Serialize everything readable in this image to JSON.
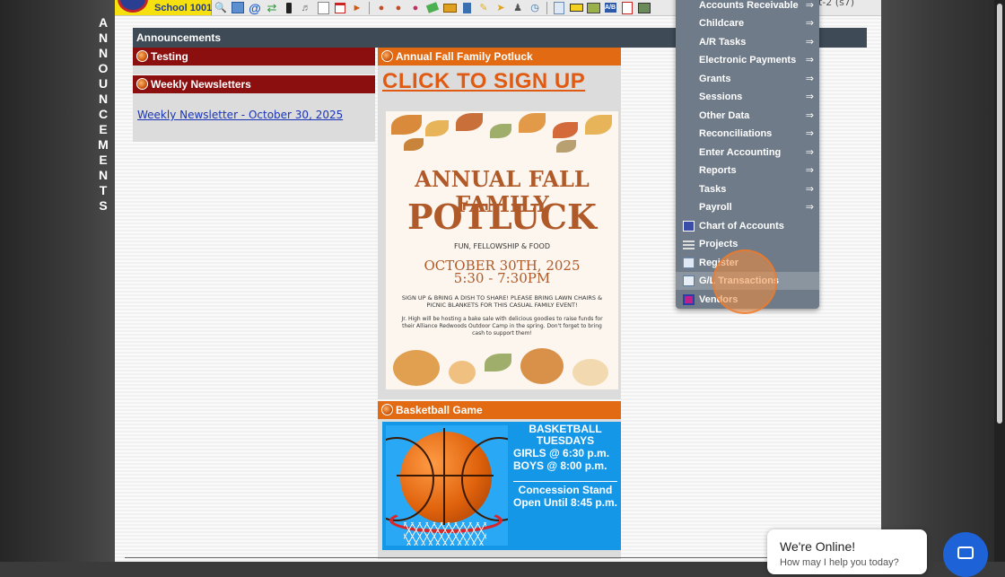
{
  "school": {
    "name": "School 1001"
  },
  "vertical_title": [
    "A",
    "N",
    "N",
    "O",
    "U",
    "N",
    "C",
    "E",
    "M",
    "E",
    "N",
    "T",
    "S"
  ],
  "toolbar": {
    "icons": [
      "magnifier-icon",
      "spreadsheet-icon",
      "at-sign-icon",
      "exchange-icon",
      "phone-icon",
      "speaker-icon",
      "notepad-icon",
      "calendar-icon",
      "megaphone-icon",
      "person-icon",
      "person-icon",
      "people-icon",
      "wallet-icon",
      "ticket-icon",
      "ledger-icon",
      "note-icon",
      "arrow-icon",
      "users-icon",
      "clock-icon",
      "document-icon",
      "card-icon",
      "printer-icon",
      "ab-icon",
      "pdf-icon",
      "money-icon"
    ],
    "topright_fragment": "t-2 (s7)"
  },
  "announcements": {
    "header": "Announcements",
    "testing_title": "Testing",
    "newsletters_title": "Weekly Newsletters",
    "newsletter_link": "Weekly Newsletter - October 30, 2025",
    "potluck_title": "Annual Fall Family Potluck",
    "signup_link": "CLICK TO SIGN UP",
    "flyer": {
      "line1": "ANNUAL FALL FAMILY",
      "line2": "POTLUCK",
      "line3": "FUN, FELLOWSHIP & FOOD",
      "date": "OCTOBER 30TH, 2025",
      "time": "5:30 - 7:30PM",
      "instructions": "SIGN UP & BRING A DISH TO SHARE! PLEASE BRING LAWN CHAIRS & PICNIC BLANKETS FOR THIS CASUAL FAMILY EVENT!",
      "note": "Jr. High will be hosting a bake sale with delicious goodies to raise funds for their Alliance Redwoods Outdoor Camp in the spring. Don't forget to bring cash to support them!"
    },
    "basketball_title": "Basketball Game",
    "basketball": {
      "line1": "BASKETBALL",
      "line2": "TUESDAYS",
      "line3": "GIRLS @ 6:30 p.m.",
      "line4": "BOYS  @ 8:00 p.m.",
      "line5": "Concession Stand",
      "line6": "Open Until 8:45 p.m."
    }
  },
  "menu": {
    "arrow": "⇒",
    "items": [
      {
        "label": "Accounts Receivable",
        "submenu": true
      },
      {
        "label": "Childcare",
        "submenu": true
      },
      {
        "label": "A/R Tasks",
        "submenu": true
      },
      {
        "label": "Electronic Payments",
        "submenu": true
      },
      {
        "label": "Grants",
        "submenu": true
      },
      {
        "label": "Sessions",
        "submenu": true
      },
      {
        "label": "Other Data",
        "submenu": true
      },
      {
        "label": "Reconciliations",
        "submenu": true
      },
      {
        "label": "Enter Accounting",
        "submenu": true
      },
      {
        "label": "Reports",
        "submenu": true
      },
      {
        "label": "Tasks",
        "submenu": true
      },
      {
        "label": "Payroll",
        "submenu": true
      },
      {
        "label": "Chart of Accounts",
        "icon": "chart-of-accounts-icon"
      },
      {
        "label": "Projects",
        "icon": "projects-list-icon"
      },
      {
        "label": "Register",
        "icon": "register-icon"
      },
      {
        "label": "G/L Transactions",
        "icon": "gl-transactions-icon",
        "hovered": true
      },
      {
        "label": "Vendors",
        "icon": "vendors-icon"
      }
    ]
  },
  "chat": {
    "title": "We're Online!",
    "subtitle": "How may I help you today?"
  }
}
